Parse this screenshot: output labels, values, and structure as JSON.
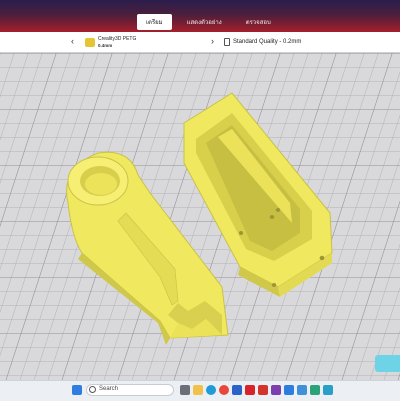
{
  "header": {
    "tabs": [
      {
        "label": "เตรียม",
        "active": true
      },
      {
        "label": "แสดงตัวอย่าง",
        "active": false
      },
      {
        "label": "ตรวจสอบ",
        "active": false
      }
    ]
  },
  "settings": {
    "material": {
      "name": "Creality3D PETG",
      "size": "0.4mm",
      "icon": "spool-icon",
      "color": "#e6c534"
    },
    "quality": {
      "label": "Standard Quality - 0.2mm",
      "icon": "print-settings-icon"
    }
  },
  "viewport": {
    "plate_color": "#d9d9dc",
    "grid_color": "#a8a8ad",
    "model_color": "#f4ee6c",
    "model_shadow": "#cfc84a"
  },
  "taskbar": {
    "search_placeholder": "Search",
    "icons": [
      "windows-start-icon",
      "search-icon",
      "task-view-icon",
      "file-explorer-icon",
      "edge-icon",
      "chrome-icon",
      "store-icon",
      "app-red-icon",
      "app-purple-icon",
      "vscode-icon",
      "app-blue-icon",
      "app-green-icon"
    ]
  }
}
